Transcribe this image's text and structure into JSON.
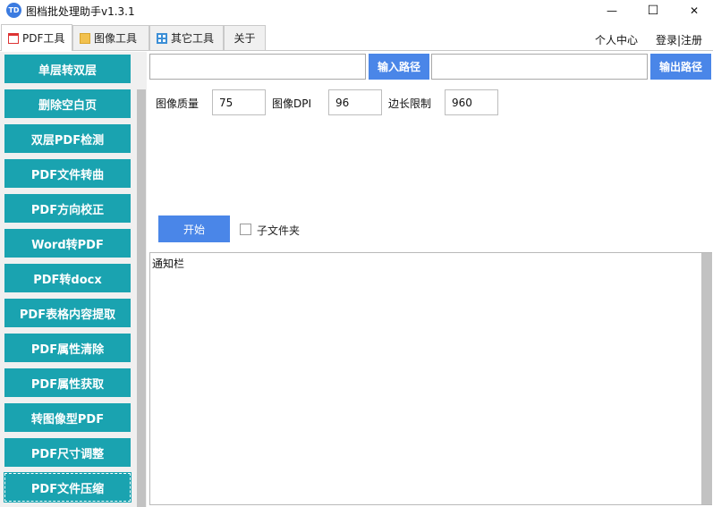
{
  "window": {
    "title": "图档批处理助手v1.3.1",
    "icon_text": "TD",
    "minimize_glyph": "—",
    "maximize_glyph": "☐",
    "close_glyph": "✕"
  },
  "tabs": [
    {
      "label": "PDF工具",
      "icon": "pdf-file-icon",
      "active": true
    },
    {
      "label": "图像工具",
      "icon": "image-file-icon",
      "active": false
    },
    {
      "label": "其它工具",
      "icon": "grid-icon",
      "active": false
    },
    {
      "label": "关于",
      "active": false
    }
  ],
  "top_links": {
    "profile": "个人中心",
    "login": "登录|注册"
  },
  "sidebar": {
    "items": [
      {
        "label": "单层转双层"
      },
      {
        "label": "删除空白页"
      },
      {
        "label": "双层PDF检测"
      },
      {
        "label": "PDF文件转曲"
      },
      {
        "label": "PDF方向校正"
      },
      {
        "label": "Word转PDF"
      },
      {
        "label": "PDF转docx"
      },
      {
        "label": "PDF表格内容提取"
      },
      {
        "label": "PDF属性清除"
      },
      {
        "label": "PDF属性获取"
      },
      {
        "label": "转图像型PDF"
      },
      {
        "label": "PDF尺寸调整"
      },
      {
        "label": "PDF文件压缩",
        "selected": true
      }
    ]
  },
  "paths": {
    "input_value": "",
    "input_button": "输入路径",
    "output_value": "",
    "output_button": "输出路径"
  },
  "params": {
    "quality_label": "图像质量",
    "quality_value": "75",
    "dpi_label": "图像DPI",
    "dpi_value": "96",
    "edge_label": "边长限制",
    "edge_value": "960"
  },
  "actions": {
    "start_label": "开始",
    "subfolder_label": "子文件夹",
    "subfolder_checked": false
  },
  "notice": {
    "title": "通知栏"
  },
  "colors": {
    "sidebar_button": "#1aa3b0",
    "primary_button": "#4a86e8"
  }
}
